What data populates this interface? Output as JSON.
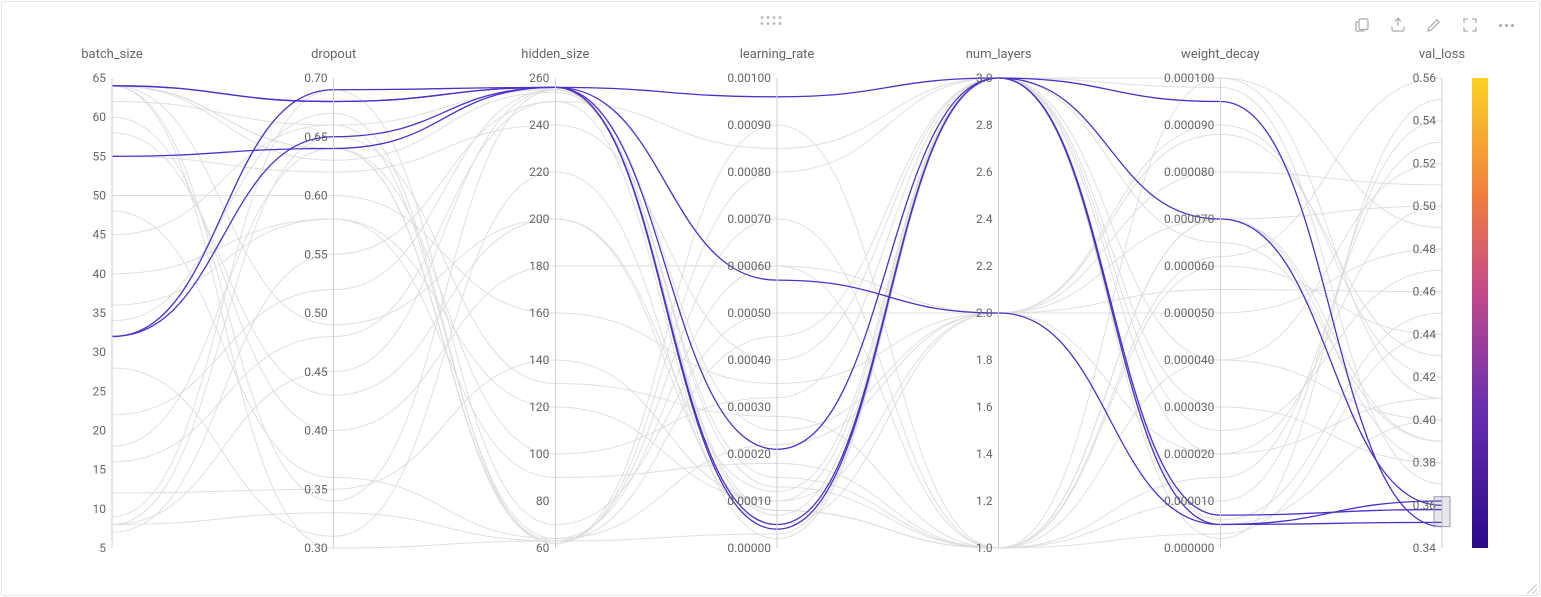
{
  "chart_data": {
    "type": "parallel_coordinates",
    "axes": [
      {
        "name": "batch_size",
        "range": [
          5,
          65
        ],
        "ticks": [
          5,
          10,
          15,
          20,
          25,
          30,
          35,
          40,
          45,
          50,
          55,
          60,
          65
        ],
        "tick_fmt": "int"
      },
      {
        "name": "dropout",
        "range": [
          0.3,
          0.7
        ],
        "ticks": [
          0.3,
          0.35,
          0.4,
          0.45,
          0.5,
          0.55,
          0.6,
          0.65,
          0.7
        ],
        "tick_fmt": "f2"
      },
      {
        "name": "hidden_size",
        "range": [
          60,
          260
        ],
        "ticks": [
          60,
          80,
          100,
          120,
          140,
          160,
          180,
          200,
          220,
          240,
          260
        ],
        "tick_fmt": "int"
      },
      {
        "name": "learning_rate",
        "range": [
          0.0,
          0.001
        ],
        "ticks": [
          0.0,
          0.0001,
          0.0002,
          0.0003,
          0.0004,
          0.0005,
          0.0006,
          0.0007,
          0.0008,
          0.0009,
          0.001
        ],
        "tick_fmt": "f5"
      },
      {
        "name": "num_layers",
        "range": [
          1.0,
          3.0
        ],
        "ticks": [
          1.0,
          1.2,
          1.4,
          1.6,
          1.8,
          2.0,
          2.2,
          2.4,
          2.6,
          2.8,
          3.0
        ],
        "tick_fmt": "f1"
      },
      {
        "name": "weight_decay",
        "range": [
          0.0,
          0.0001
        ],
        "ticks": [
          0.0,
          1e-05,
          2e-05,
          3e-05,
          4e-05,
          5e-05,
          6e-05,
          7e-05,
          8e-05,
          9e-05,
          0.0001
        ],
        "tick_fmt": "f6"
      },
      {
        "name": "val_loss",
        "range": [
          0.34,
          0.56
        ],
        "ticks": [
          0.34,
          0.36,
          0.38,
          0.4,
          0.42,
          0.44,
          0.46,
          0.48,
          0.5,
          0.52,
          0.54,
          0.56
        ],
        "tick_fmt": "f2"
      }
    ],
    "color_axis": "val_loss",
    "color_scale": {
      "domain": [
        0.34,
        0.56
      ],
      "stops": [
        {
          "t": 0.0,
          "color": "#2a0a8a"
        },
        {
          "t": 0.3,
          "color": "#6a2fb0"
        },
        {
          "t": 0.55,
          "color": "#c54a8a"
        },
        {
          "t": 0.75,
          "color": "#f07e3e"
        },
        {
          "t": 1.0,
          "color": "#fbd324"
        }
      ]
    },
    "brush": {
      "axis": "val_loss",
      "range": [
        0.35,
        0.364
      ]
    },
    "highlighted_runs": [
      {
        "batch_size": 64,
        "dropout": 0.68,
        "hidden_size": 256,
        "learning_rate": 4e-05,
        "num_layers": 3.0,
        "weight_decay": 9.5e-05,
        "val_loss": 0.35
      },
      {
        "batch_size": 64,
        "dropout": 0.68,
        "hidden_size": 256,
        "learning_rate": 5e-05,
        "num_layers": 3.0,
        "weight_decay": 7e-06,
        "val_loss": 0.358
      },
      {
        "batch_size": 32,
        "dropout": 0.69,
        "hidden_size": 256,
        "learning_rate": 0.00021,
        "num_layers": 3.0,
        "weight_decay": 5e-06,
        "val_loss": 0.352
      },
      {
        "batch_size": 32,
        "dropout": 0.65,
        "hidden_size": 256,
        "learning_rate": 0.00057,
        "num_layers": 2.0,
        "weight_decay": 5e-06,
        "val_loss": 0.362
      },
      {
        "batch_size": 55,
        "dropout": 0.64,
        "hidden_size": 256,
        "learning_rate": 0.00096,
        "num_layers": 3.0,
        "weight_decay": 7e-05,
        "val_loss": 0.36
      }
    ],
    "background_runs": [
      {
        "batch_size": 8,
        "dropout": 0.65,
        "hidden_size": 130,
        "learning_rate": 0.00028,
        "num_layers": 1.0,
        "weight_decay": 6e-05,
        "val_loss": 0.44
      },
      {
        "batch_size": 64,
        "dropout": 0.34,
        "hidden_size": 255,
        "learning_rate": 8e-05,
        "num_layers": 1.0,
        "weight_decay": 6.2e-05,
        "val_loss": 0.56
      },
      {
        "batch_size": 64,
        "dropout": 0.64,
        "hidden_size": 63,
        "learning_rate": 0.0007,
        "num_layers": 1.0,
        "weight_decay": 7e-05,
        "val_loss": 0.5
      },
      {
        "batch_size": 8,
        "dropout": 0.33,
        "hidden_size": 63,
        "learning_rate": 3e-05,
        "num_layers": 3.0,
        "weight_decay": 0.0001,
        "val_loss": 0.49
      },
      {
        "batch_size": 55,
        "dropout": 0.62,
        "hidden_size": 240,
        "learning_rate": 0.0004,
        "num_layers": 3.0,
        "weight_decay": 5e-06,
        "val_loss": 0.4
      },
      {
        "batch_size": 64,
        "dropout": 0.49,
        "hidden_size": 200,
        "learning_rate": 0.00012,
        "num_layers": 3.0,
        "weight_decay": 2e-05,
        "val_loss": 0.41
      },
      {
        "batch_size": 45,
        "dropout": 0.66,
        "hidden_size": 64,
        "learning_rate": 0.0006,
        "num_layers": 2.0,
        "weight_decay": 5.5e-05,
        "val_loss": 0.46
      },
      {
        "batch_size": 8,
        "dropout": 0.45,
        "hidden_size": 255,
        "learning_rate": 0.00013,
        "num_layers": 1.0,
        "weight_decay": 7e-05,
        "val_loss": 0.38
      },
      {
        "batch_size": 22,
        "dropout": 0.52,
        "hidden_size": 255,
        "learning_rate": 7e-05,
        "num_layers": 3.0,
        "weight_decay": 9.8e-05,
        "val_loss": 0.37
      },
      {
        "batch_size": 64,
        "dropout": 0.3,
        "hidden_size": 63,
        "learning_rate": 0.00045,
        "num_layers": 3.0,
        "weight_decay": 2e-06,
        "val_loss": 0.55
      },
      {
        "batch_size": 50,
        "dropout": 0.6,
        "hidden_size": 160,
        "learning_rate": 0.00035,
        "num_layers": 2.0,
        "weight_decay": 8.8e-05,
        "val_loss": 0.43
      },
      {
        "batch_size": 34,
        "dropout": 0.67,
        "hidden_size": 62,
        "learning_rate": 0.0009,
        "num_layers": 1.0,
        "weight_decay": 1e-05,
        "val_loss": 0.54
      },
      {
        "batch_size": 12,
        "dropout": 0.35,
        "hidden_size": 140,
        "learning_rate": 0.0001,
        "num_layers": 2.0,
        "weight_decay": 5e-05,
        "val_loss": 0.48
      },
      {
        "batch_size": 62,
        "dropout": 0.66,
        "hidden_size": 255,
        "learning_rate": 0.00025,
        "num_layers": 2.0,
        "weight_decay": 7e-05,
        "val_loss": 0.39
      },
      {
        "batch_size": 40,
        "dropout": 0.58,
        "hidden_size": 90,
        "learning_rate": 0.00018,
        "num_layers": 1.0,
        "weight_decay": 4e-05,
        "val_loss": 0.52
      },
      {
        "batch_size": 18,
        "dropout": 0.64,
        "hidden_size": 62,
        "learning_rate": 0.0008,
        "num_layers": 3.0,
        "weight_decay": 2.5e-05,
        "val_loss": 0.47
      },
      {
        "batch_size": 28,
        "dropout": 0.31,
        "hidden_size": 220,
        "learning_rate": 5e-05,
        "num_layers": 2.0,
        "weight_decay": 9e-05,
        "val_loss": 0.42
      },
      {
        "batch_size": 60,
        "dropout": 0.4,
        "hidden_size": 180,
        "learning_rate": 0.0006,
        "num_layers": 1.0,
        "weight_decay": 1.5e-05,
        "val_loss": 0.53
      },
      {
        "batch_size": 64,
        "dropout": 0.64,
        "hidden_size": 100,
        "learning_rate": 0.00032,
        "num_layers": 3.0,
        "weight_decay": 6e-06,
        "val_loss": 0.45
      },
      {
        "batch_size": 7,
        "dropout": 0.55,
        "hidden_size": 250,
        "learning_rate": 2e-05,
        "num_layers": 3.0,
        "weight_decay": 4e-05,
        "val_loss": 0.4
      },
      {
        "batch_size": 48,
        "dropout": 0.36,
        "hidden_size": 64,
        "learning_rate": 0.00022,
        "num_layers": 2.0,
        "weight_decay": 8e-05,
        "val_loss": 0.51
      },
      {
        "batch_size": 64,
        "dropout": 0.63,
        "hidden_size": 254,
        "learning_rate": 0.00015,
        "num_layers": 1.0,
        "weight_decay": 3e-06,
        "val_loss": 0.44
      },
      {
        "batch_size": 36,
        "dropout": 0.58,
        "hidden_size": 120,
        "learning_rate": 0.0001,
        "num_layers": 3.0,
        "weight_decay": 6.5e-05,
        "val_loss": 0.39
      },
      {
        "batch_size": 9,
        "dropout": 0.69,
        "hidden_size": 70,
        "learning_rate": 0.0005,
        "num_layers": 2.0,
        "weight_decay": 2e-05,
        "val_loss": 0.5
      },
      {
        "batch_size": 58,
        "dropout": 0.43,
        "hidden_size": 200,
        "learning_rate": 8e-05,
        "num_layers": 1.0,
        "weight_decay": 0.0001,
        "val_loss": 0.41
      },
      {
        "batch_size": 16,
        "dropout": 0.48,
        "hidden_size": 250,
        "learning_rate": 0.00085,
        "num_layers": 3.0,
        "weight_decay": 3e-05,
        "val_loss": 0.38
      }
    ]
  },
  "toolbar": {
    "copy": "Copy",
    "export": "Export",
    "edit": "Edit",
    "fullscreen": "Fullscreen",
    "more": "More"
  }
}
